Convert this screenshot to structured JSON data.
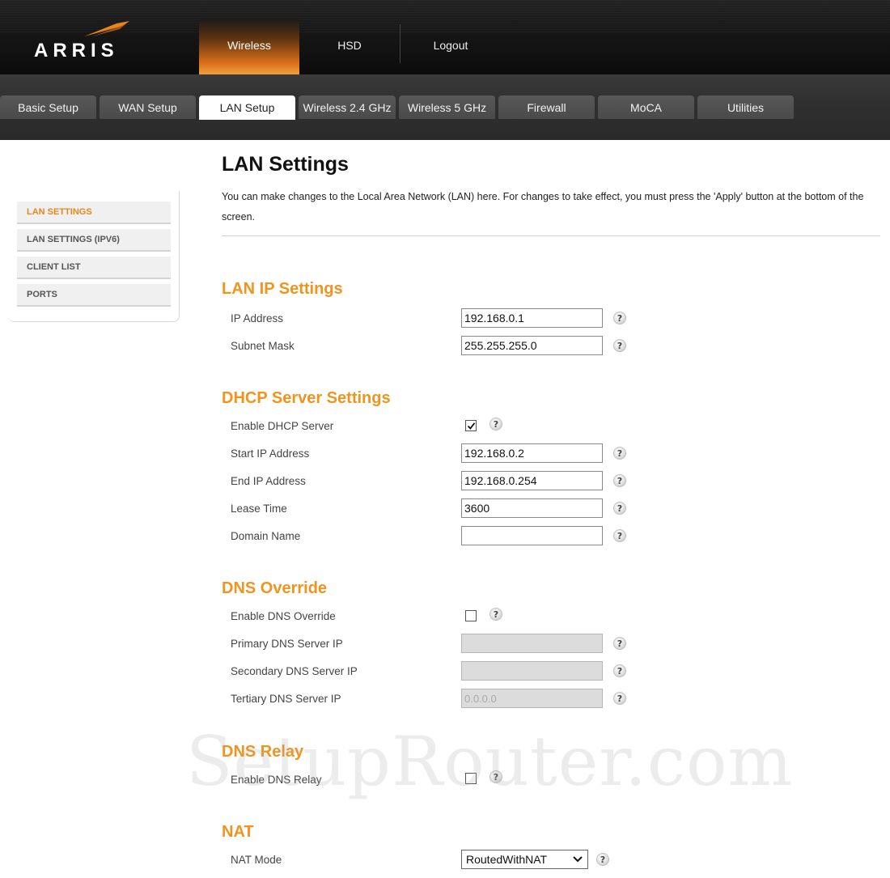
{
  "header": {
    "logo_text": "ARRIS",
    "nav": [
      {
        "label": "Wireless",
        "active": true
      },
      {
        "label": "HSD",
        "active": false
      },
      {
        "label": "Logout",
        "active": false
      }
    ]
  },
  "subnav": {
    "tabs": [
      {
        "label": "Basic Setup"
      },
      {
        "label": "WAN Setup"
      },
      {
        "label": "LAN Setup",
        "active": true
      },
      {
        "label": "Wireless 2.4 GHz"
      },
      {
        "label": "Wireless 5 GHz"
      },
      {
        "label": "Firewall"
      },
      {
        "label": "MoCA"
      },
      {
        "label": "Utilities"
      }
    ]
  },
  "sidebar": {
    "items": [
      {
        "label": "LAN SETTINGS",
        "active": true
      },
      {
        "label": "LAN SETTINGS (IPV6)"
      },
      {
        "label": "CLIENT LIST"
      },
      {
        "label": "PORTS"
      }
    ]
  },
  "main": {
    "title": "LAN Settings",
    "intro": "You can make changes to the Local Area Network (LAN) here. For changes to take effect, you must press the 'Apply' button at the bottom of the screen.",
    "help_glyph": "?",
    "lan_ip": {
      "title": "LAN IP Settings",
      "ip_label": "IP Address",
      "ip_value": "192.168.0.1",
      "mask_label": "Subnet Mask",
      "mask_value": "255.255.255.0"
    },
    "dhcp": {
      "title": "DHCP Server Settings",
      "enable_label": "Enable DHCP Server",
      "enabled": true,
      "start_label": "Start IP Address",
      "start_value": "192.168.0.2",
      "end_label": "End IP Address",
      "end_value": "192.168.0.254",
      "lease_label": "Lease Time",
      "lease_value": "3600",
      "domain_label": "Domain Name",
      "domain_value": ""
    },
    "dns_override": {
      "title": "DNS Override",
      "enable_label": "Enable DNS Override",
      "enabled": false,
      "primary_label": "Primary DNS Server IP",
      "primary_value": "",
      "secondary_label": "Secondary DNS Server IP",
      "secondary_value": "",
      "tertiary_label": "Tertiary DNS Server IP",
      "tertiary_value": "0.0.0.0"
    },
    "dns_relay": {
      "title": "DNS Relay",
      "enable_label": "Enable DNS Relay",
      "enabled": false
    },
    "nat": {
      "title": "NAT",
      "mode_label": "NAT Mode",
      "mode_value": "RoutedWithNAT"
    }
  },
  "watermark": "SetupRouter.com",
  "colors": {
    "accent": "#f0941e",
    "active_sidebar": "#e8861a",
    "header_bg": "#141414"
  }
}
